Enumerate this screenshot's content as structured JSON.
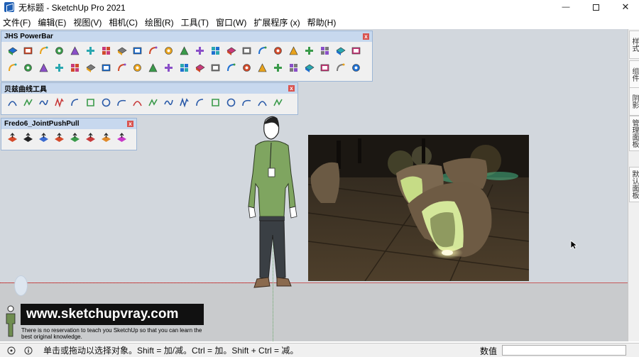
{
  "window": {
    "title": "无标题 - SketchUp Pro 2021",
    "controls": {
      "minimize": "—",
      "close": "✕"
    }
  },
  "menu": [
    "文件(F)",
    "编辑(E)",
    "视图(V)",
    "相机(C)",
    "绘图(R)",
    "工具(T)",
    "窗口(W)",
    "扩展程序 (x)",
    "帮助(H)"
  ],
  "toolbars": {
    "jhs": {
      "title": "JHS PowerBar",
      "row1": [
        "cube-blue",
        "cube-blue2",
        "plane-yellow",
        "plane-green",
        "cube-red",
        "stack-icon",
        "rotate-orange",
        "rotate-yellow",
        "cross-orange",
        "panel-red",
        "frame-red",
        "flag-icon",
        "capsule-yellow",
        "tube-gray",
        "arrow-curve",
        "dots-red",
        "dots-blue",
        "plus-red",
        "plus-green",
        "cross-blue",
        "grid-blue",
        "tri-blue",
        "tri-green"
      ],
      "row2": [
        "warning-icon",
        "arc-orange",
        "hook-orange",
        "circle-blue",
        "move-blue",
        "cone-blue",
        "box-brown",
        "arc-red",
        "puzzle-green",
        "box-multi",
        "box-multi2",
        "stack-blue",
        "hex-orange",
        "cells-blue",
        "grid-dark",
        "grid-dark2",
        "grid-dark3",
        "grid-teal",
        "grid-orange",
        "grid-orange2",
        "dots-multi",
        "arc-dotted",
        "grid-rotate"
      ]
    },
    "bezier": {
      "title": "贝兹曲线工具",
      "buttons": [
        "bezier-arc",
        "bezier-curve",
        "bezier-spline",
        "bezier-zigzag",
        "bezier-polyline",
        "bezier-arc-green",
        "bezier-rect",
        "bezier-spiral",
        "bezier-hook",
        "bezier-wave",
        "bezier-loop",
        "bezier-arc2",
        "bezier-arc-red",
        "bezier-check",
        "bezier-circle",
        "bezier-wrench",
        "bezier-blob",
        "bezier-edit"
      ]
    },
    "fredo": {
      "title": "Fredo6_JointPushPull",
      "buttons": [
        "jpp-joint",
        "jpp-normal",
        "jpp-vector",
        "jpp-extrude",
        "jpp-follow",
        "jpp-undo",
        "jpp-redo",
        "jpp-fix"
      ]
    }
  },
  "side_tabs": [
    "样式",
    "组件",
    "阴影",
    "管理面板",
    "默认面板"
  ],
  "watermark": {
    "url": "www.sketchupvray.com",
    "caption": "There is no reservation to teach you SketchUp so that you can learn the best original knowledge."
  },
  "status": {
    "hint": "单击或拖动以选择对象。Shift = 加/减。Ctrl = 加。Shift + Ctrl = 减。",
    "measurement_label": "数值",
    "measurement_value": ""
  },
  "colors": {
    "accent": "#1f5fb4",
    "viewport_sky": "#d2d7dd",
    "viewport_ground": "#c9cbcd",
    "axis_red": "#c23a3a",
    "axis_green": "#6aa86a"
  }
}
